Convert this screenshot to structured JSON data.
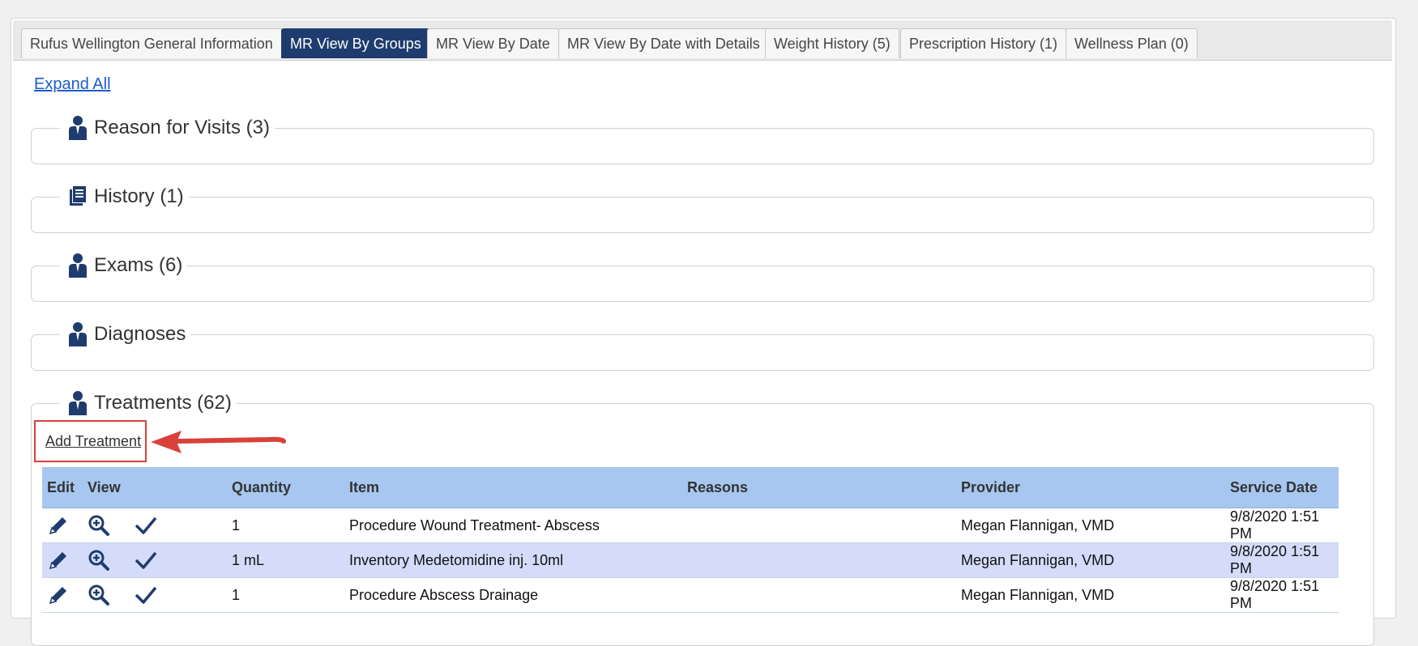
{
  "tabs": [
    {
      "label": "Rufus Wellington General Information",
      "active": false
    },
    {
      "label": "MR View By Groups",
      "active": true
    },
    {
      "label": "MR View By Date",
      "active": false
    },
    {
      "label": "MR View By Date with Details",
      "active": false
    },
    {
      "label": "Weight History (5)",
      "active": false
    },
    {
      "label": "Prescription History (1)",
      "active": false
    },
    {
      "label": "Wellness Plan (0)",
      "active": false
    }
  ],
  "expand_all": "Expand All",
  "sections": [
    {
      "label": "Reason for Visits (3)",
      "icon": "person-icon"
    },
    {
      "label": "History (1)",
      "icon": "documents-icon"
    },
    {
      "label": "Exams (6)",
      "icon": "person-icon"
    },
    {
      "label": "Diagnoses",
      "icon": "person-icon"
    },
    {
      "label": "Treatments (62)",
      "icon": "person-icon"
    }
  ],
  "treatments": {
    "add_label": "Add Treatment",
    "columns": {
      "edit": "Edit",
      "view": "View",
      "quantity": "Quantity",
      "item": "Item",
      "reasons": "Reasons",
      "provider": "Provider",
      "service_date": "Service Date"
    },
    "rows": [
      {
        "quantity": "1",
        "item": "Procedure Wound Treatment- Abscess",
        "reasons": "",
        "provider": "Megan Flannigan, VMD",
        "service_date": "9/8/2020 1:51 PM"
      },
      {
        "quantity": "1 mL",
        "item": "Inventory Medetomidine inj. 10ml",
        "reasons": "",
        "provider": "Megan Flannigan, VMD",
        "service_date": "9/8/2020 1:51 PM"
      },
      {
        "quantity": "1",
        "item": "Procedure Abscess Drainage",
        "reasons": "",
        "provider": "Megan Flannigan, VMD",
        "service_date": "9/8/2020 1:51 PM"
      }
    ]
  },
  "colors": {
    "active_tab": "#1f3c6e",
    "header_row": "#a7c7f0",
    "alt_row": "#d4dcfa",
    "highlight": "#d9413a",
    "icon": "#1f3c6e"
  }
}
